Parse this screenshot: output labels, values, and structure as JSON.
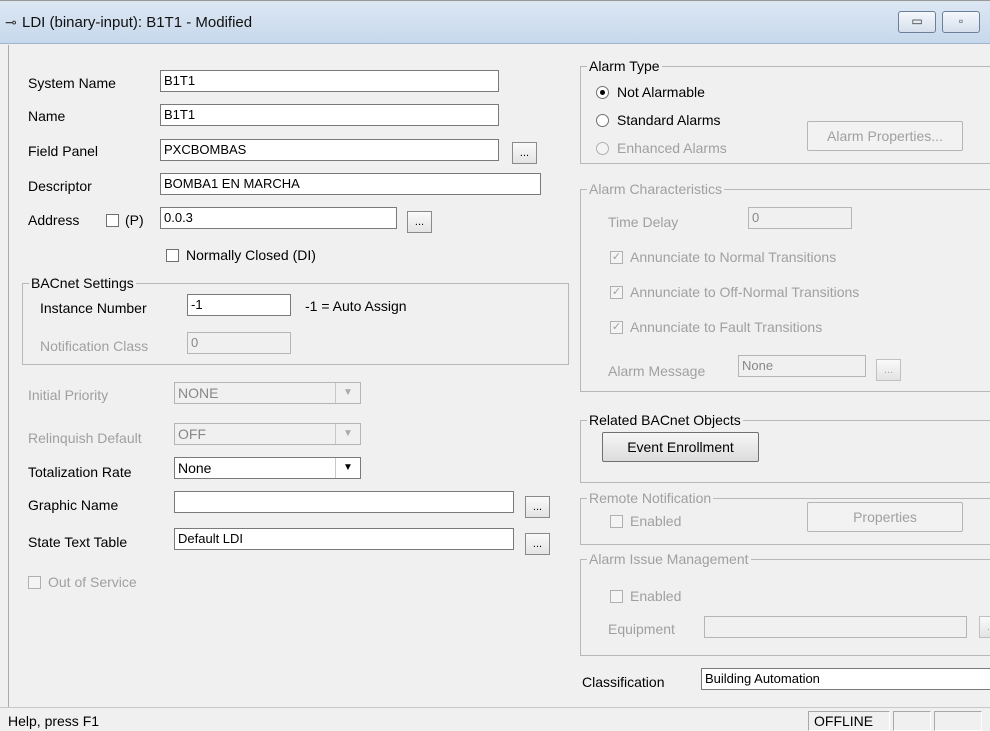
{
  "window": {
    "title": "LDI (binary-input): B1T1  - Modified",
    "icon": "object-icon",
    "minimize_glyph": "▭",
    "maximize_glyph": "▫"
  },
  "form": {
    "system_name_label": "System Name",
    "system_name_value": "B1T1",
    "name_label": "Name",
    "name_value": "B1T1",
    "field_panel_label": "Field Panel",
    "field_panel_value": "PXCBOMBAS",
    "descriptor_label": "Descriptor",
    "descriptor_value": "BOMBA1 EN MARCHA",
    "address_label": "Address",
    "address_p_label": "(P)",
    "address_value": "0.0.3",
    "normally_closed_label": "Normally Closed (DI)",
    "browse_label": "..."
  },
  "bacnet": {
    "group_title": "BACnet Settings",
    "instance_label": "Instance Number",
    "instance_value": "-1",
    "instance_hint": "-1 = Auto Assign",
    "notification_label": "Notification Class",
    "notification_value": "0"
  },
  "priorities": {
    "initial_priority_label": "Initial Priority",
    "initial_priority_value": "NONE",
    "relinquish_label": "Relinquish Default",
    "relinquish_value": "OFF",
    "totalization_label": "Totalization Rate",
    "totalization_value": "None",
    "graphic_label": "Graphic Name",
    "graphic_value": "",
    "state_text_label": "State Text Table",
    "state_text_value": "Default LDI",
    "out_of_service_label": "Out of Service"
  },
  "alarm_type": {
    "group_title": "Alarm Type",
    "not_alarmable": "Not Alarmable",
    "standard": "Standard Alarms",
    "enhanced": "Enhanced Alarms",
    "selected": "Not Alarmable",
    "properties_button": "Alarm Properties..."
  },
  "alarm_characteristics": {
    "group_title": "Alarm Characteristics",
    "time_delay_label": "Time Delay",
    "time_delay_value": "0",
    "normal_transitions": "Annunciate to Normal Transitions",
    "off_normal_transitions": "Annunciate to Off-Normal Transitions",
    "fault_transitions": "Annunciate to Fault Transitions",
    "alarm_message_label": "Alarm Message",
    "alarm_message_value": "None"
  },
  "related": {
    "group_title": "Related BACnet Objects",
    "event_enrollment_button": "Event Enrollment"
  },
  "remote_notification": {
    "group_title": "Remote Notification",
    "enabled_label": "Enabled",
    "properties_button": "Properties"
  },
  "alarm_issue": {
    "group_title": "Alarm Issue Management",
    "enabled_label": "Enabled",
    "equipment_label": "Equipment",
    "equipment_value": ""
  },
  "classification": {
    "label": "Classification",
    "value": "Building Automation"
  },
  "statusbar": {
    "help": "Help, press F1",
    "state": "OFFLINE"
  },
  "glyphs": {
    "check": "✓",
    "dropdown": "▼"
  }
}
